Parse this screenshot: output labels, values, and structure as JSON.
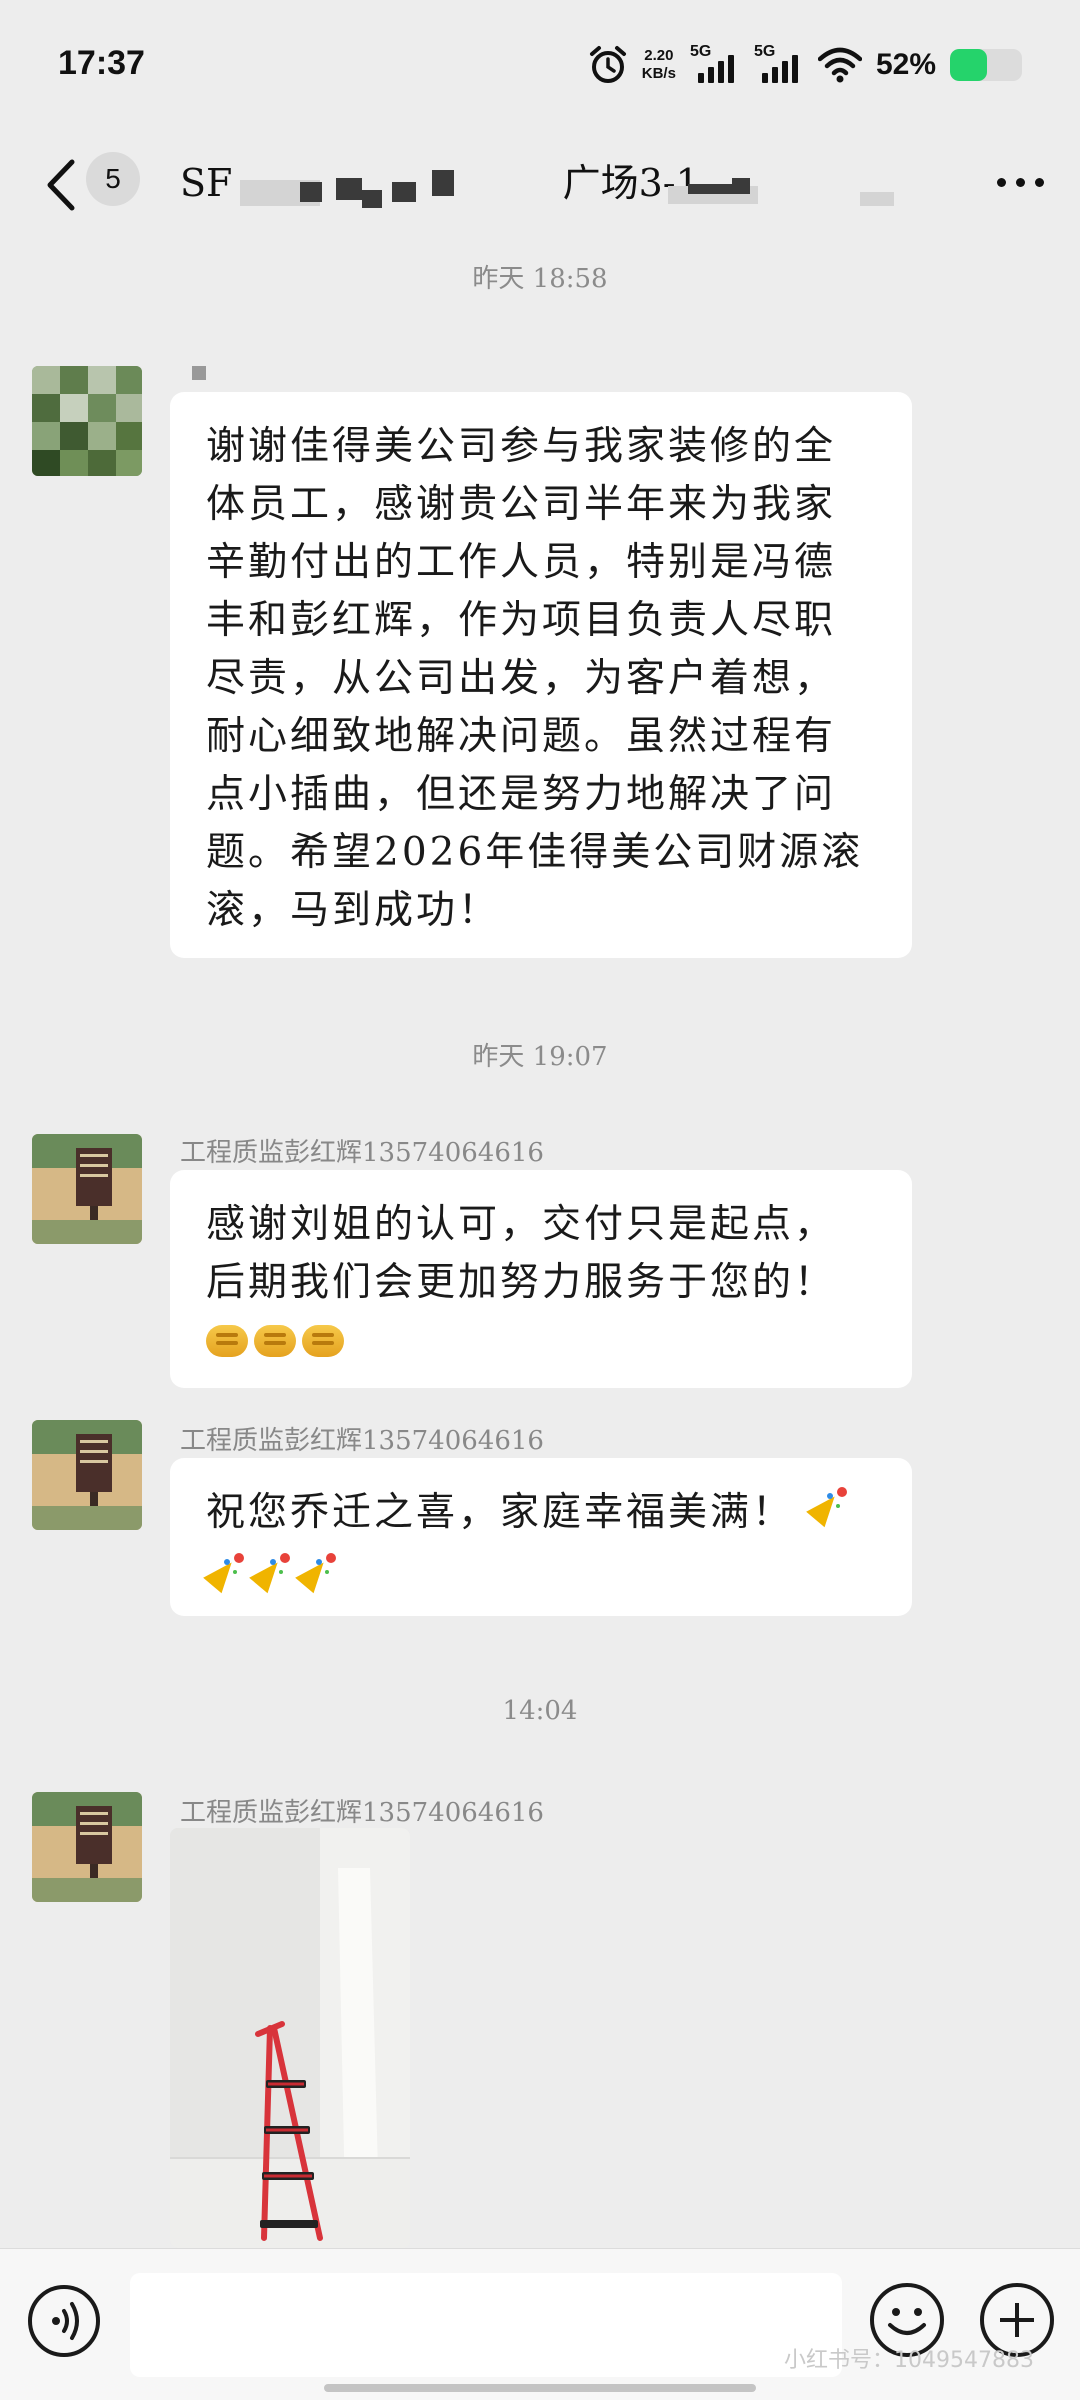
{
  "status_bar": {
    "time": "17:37",
    "net_speed_value": "2.20",
    "net_speed_unit": "KB/s",
    "signal_1": "5G",
    "signal_2": "5G",
    "battery_percent": "52%",
    "battery_level": 0.52,
    "battery_color": "#25d36b"
  },
  "nav": {
    "unread_count": "5",
    "title_prefix": "SF",
    "title_middle": "广场3-1"
  },
  "messages": [
    {
      "time_label": "昨天 18:58",
      "sender": "",
      "text": "谢谢佳得美公司参与我家装修的全体员工，感谢贵公司半年来为我家辛勤付出的工作人员，特别是冯德丰和彭红辉，作为项目负责人尽职尽责，从公司出发，为客户着想，耐心细致地解决问题。虽然过程有点小插曲，但还是努力地解决了问题。希望2026年佳得美公司财源滚滚，马到成功！"
    },
    {
      "time_label": "昨天 19:07",
      "sender": "工程质监彭红辉13574064616",
      "text": "感谢刘姐的认可，交付只是起点，后期我们会更加努力服务于您的！",
      "emoji": [
        "handshake-icon",
        "handshake-icon",
        "handshake-icon"
      ]
    },
    {
      "sender": "工程质监彭红辉13574064616",
      "text": "祝您乔迁之喜，家庭幸福美满！",
      "emoji": [
        "party-popper-icon",
        "party-popper-icon",
        "party-popper-icon",
        "party-popper-icon"
      ]
    },
    {
      "time_label": "14:04",
      "sender": "工程质监彭红辉13574064616",
      "image": "photo-of-folding-step-ladder"
    }
  ],
  "input": {
    "value": "",
    "placeholder": ""
  },
  "watermark": "小红书号：1049547883",
  "colors": {
    "background": "#ededed",
    "bubble": "#ffffff",
    "ladder_red": "#d8343b"
  }
}
